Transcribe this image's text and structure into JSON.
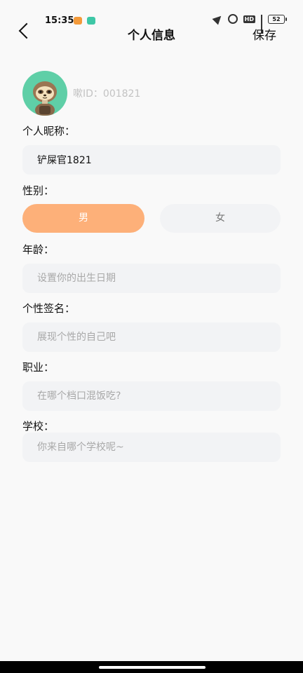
{
  "status_bar": {
    "time": "15:35",
    "battery": "52"
  },
  "header": {
    "title": "个人信息",
    "save_label": "保存"
  },
  "profile": {
    "user_id": "嗽ID：001821"
  },
  "form": {
    "nickname_label": "个人昵称：",
    "nickname_value": "铲屎官1821",
    "gender_label": "性别：",
    "gender_options": [
      "男",
      "女"
    ],
    "gender_selected": "男",
    "age_label": "年龄：",
    "age_placeholder": "设置你的出生日期",
    "signature_label": "个性签名：",
    "signature_placeholder": "展现个性的自己吧",
    "job_label": "职业：",
    "job_placeholder": "在哪个档口混饭吃?",
    "school_label": "学校：",
    "school_placeholder": "你来自哪个学校呢~"
  },
  "colors": {
    "accent": "#fdb079",
    "avatar_bg": "#5fcfa7",
    "field_bg": "#f2f3f5"
  }
}
